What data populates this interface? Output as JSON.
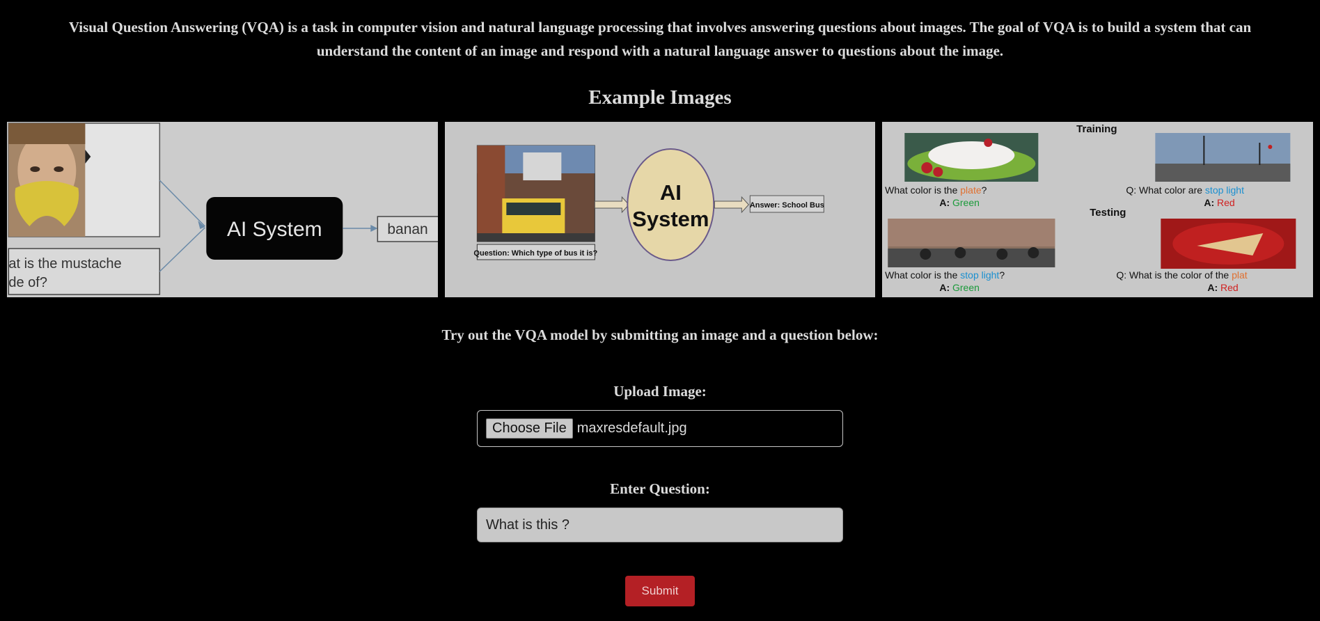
{
  "intro": {
    "line1": "Visual Question Answering (VQA) is a task in computer vision and natural language processing that involves answering questions about images. The goal of VQA is to build a system that can",
    "line2": "understand the content of an image and respond with a natural language answer to questions about the image."
  },
  "examples": {
    "title": "Example Images",
    "ex1": {
      "box_text": "AI System",
      "answer_text": "banan",
      "question_line1": "at is the mustache",
      "question_line2": "de of?"
    },
    "ex2": {
      "question_text": "Question: Which type of bus it is?",
      "ai_line1": "AI",
      "ai_line2": "System",
      "answer_text": "Answer: School Bus"
    },
    "ex3": {
      "training": "Training",
      "testing": "Testing",
      "q1_prefix": ": What color is the ",
      "q1_key": "plate",
      "q1_suffix": "?",
      "a1_prefix": "A: ",
      "a1_value": "Green",
      "q2_prefix": "Q: What color are ",
      "q2_key": "stop light",
      "a2_prefix": "A: ",
      "a2_value": "Red",
      "q3_prefix": ": What color is the ",
      "q3_key": "stop light",
      "q3_suffix": "?",
      "a3_prefix": "A: ",
      "a3_value": "Green",
      "q4_prefix": "Q: What is the color of the ",
      "q4_key": "plat",
      "a4_prefix": "A: ",
      "a4_value": "Red",
      "colors": {
        "key": "#e07030",
        "blue": "#1a8fd0",
        "green": "#1a9a3a",
        "red": "#d02020"
      }
    }
  },
  "form": {
    "prompt": "Try out the VQA model by submitting an image and a question below:",
    "upload_label": "Upload Image:",
    "choose_file_label": "Choose File",
    "file_name": "maxresdefault.jpg",
    "question_label": "Enter Question:",
    "question_value": "What is this ?",
    "submit_label": "Submit"
  },
  "colors": {
    "accent": "#b42025",
    "background": "#000000"
  }
}
